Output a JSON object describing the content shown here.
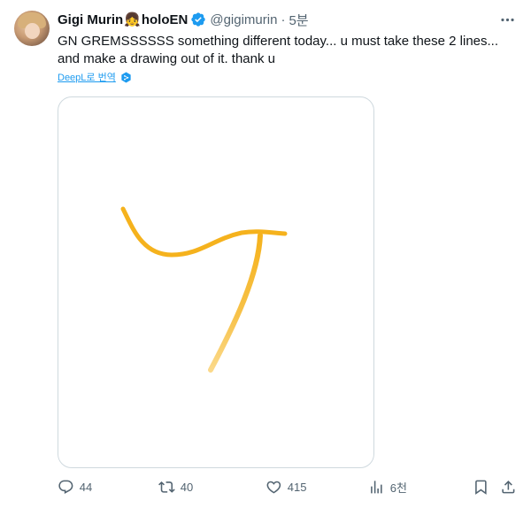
{
  "tweet": {
    "author_name": "Gigi Murin",
    "emoji": "👧",
    "affiliation": "holoEN",
    "handle": "@gigimurin",
    "separator": "·",
    "time": "5분",
    "text": "GN GREMSSSSSS something different today... u must take these 2 lines... and make a drawing out of it. thank u",
    "translate_label": "DeepL로 번역"
  },
  "icons": {
    "verified": "verified-badge-icon",
    "more": "more-dots-icon",
    "reply": "reply-icon",
    "retweet": "retweet-icon",
    "like": "heart-icon",
    "views": "views-icon",
    "bookmark": "bookmark-icon",
    "share": "share-icon",
    "deepl": "deepl-icon"
  },
  "actions": {
    "replies": "44",
    "retweets": "40",
    "likes": "415",
    "views": "6천"
  },
  "colors": {
    "accent": "#1d9bf0",
    "text": "#0f1419",
    "secondary": "#536471",
    "stroke": "#f5b21d"
  }
}
